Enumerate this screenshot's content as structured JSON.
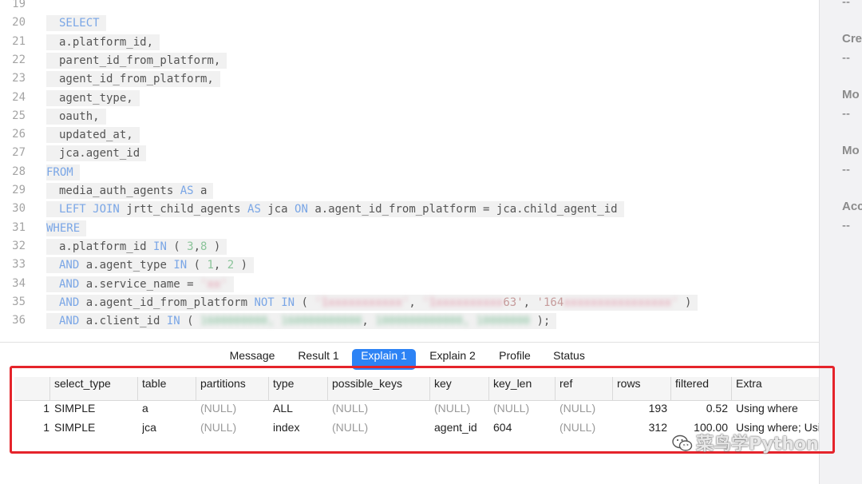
{
  "editor": {
    "lines": [
      {
        "n": "19",
        "text": ""
      },
      {
        "n": "20",
        "segs": [
          [
            "kw",
            "SELECT"
          ]
        ]
      },
      {
        "n": "21",
        "segs": [
          [
            "t",
            "a.platform_id,"
          ]
        ]
      },
      {
        "n": "22",
        "segs": [
          [
            "t",
            "parent_id_from_platform,"
          ]
        ]
      },
      {
        "n": "23",
        "segs": [
          [
            "t",
            "agent_id_from_platform,"
          ]
        ]
      },
      {
        "n": "24",
        "segs": [
          [
            "t",
            "agent_type,"
          ]
        ]
      },
      {
        "n": "25",
        "segs": [
          [
            "t",
            "oauth,"
          ]
        ]
      },
      {
        "n": "26",
        "segs": [
          [
            "t",
            "updated_at,"
          ]
        ]
      },
      {
        "n": "27",
        "segs": [
          [
            "t",
            "jca.agent_id"
          ]
        ]
      },
      {
        "n": "28",
        "segs": [
          [
            "kw",
            "FROM"
          ]
        ],
        "outdent": true
      },
      {
        "n": "29",
        "segs": [
          [
            "t",
            "media_auth_agents "
          ],
          [
            "kw",
            "AS"
          ],
          [
            "t",
            " a"
          ]
        ]
      },
      {
        "n": "30",
        "segs": [
          [
            "kw",
            "LEFT JOIN"
          ],
          [
            "t",
            " jrtt_child_agents "
          ],
          [
            "kw",
            "AS"
          ],
          [
            "t",
            " jca "
          ],
          [
            "kw",
            "ON"
          ],
          [
            "t",
            " a.agent_id_from_platform = jca.child_agent_id"
          ]
        ]
      },
      {
        "n": "31",
        "segs": [
          [
            "kw",
            "WHERE"
          ]
        ],
        "outdent": true
      },
      {
        "n": "32",
        "segs": [
          [
            "t",
            "a.platform_id "
          ],
          [
            "kw",
            "IN"
          ],
          [
            "t",
            " ( "
          ],
          [
            "num",
            "3"
          ],
          [
            "t",
            ","
          ],
          [
            "num",
            "8"
          ],
          [
            "t",
            " )"
          ]
        ]
      },
      {
        "n": "33",
        "segs": [
          [
            "kw",
            "AND"
          ],
          [
            "t",
            " a.agent_type "
          ],
          [
            "kw",
            "IN"
          ],
          [
            "t",
            " ( "
          ],
          [
            "num",
            "1"
          ],
          [
            "t",
            ", "
          ],
          [
            "num",
            "2"
          ],
          [
            "t",
            " )"
          ]
        ]
      },
      {
        "n": "34",
        "segs": [
          [
            "kw",
            "AND"
          ],
          [
            "t",
            " a.service_name = "
          ],
          [
            "blur-r",
            "'xx'"
          ]
        ]
      },
      {
        "n": "35",
        "segs": [
          [
            "kw",
            "AND"
          ],
          [
            "t",
            " a.agent_id_from_platform "
          ],
          [
            "kw",
            "NOT"
          ],
          [
            "t",
            " "
          ],
          [
            "kw",
            "IN"
          ],
          [
            "t",
            " ( "
          ],
          [
            "blur-r",
            "'1xxxxxxxxxxx'"
          ],
          [
            "t",
            ", "
          ],
          [
            "blur-r",
            "'1xxxxxxxxxx"
          ],
          [
            "str",
            "63'"
          ],
          [
            "t",
            ", "
          ],
          [
            "str",
            "'164"
          ],
          [
            "blur-r",
            "xxxxxxxxxxxxxxxx'"
          ],
          [
            "t",
            " )"
          ]
        ]
      },
      {
        "n": "36",
        "segs": [
          [
            "kw",
            "AND"
          ],
          [
            "t",
            " a.client_id "
          ],
          [
            "kw",
            "IN"
          ],
          [
            "t",
            " ( "
          ],
          [
            "blur-g",
            "1600000000, 160000000000"
          ],
          [
            "t",
            ", "
          ],
          [
            "blur-g",
            "1000000000000, 10000000"
          ],
          [
            "t",
            " );"
          ]
        ]
      }
    ]
  },
  "side": {
    "items": [
      {
        "label": "",
        "value": "--"
      },
      {
        "label": "Cre",
        "value": "--"
      },
      {
        "label": "Mo",
        "value": "--"
      },
      {
        "label": "Mo",
        "value": "--"
      },
      {
        "label": "Acc",
        "value": "--"
      }
    ]
  },
  "tabs": [
    {
      "label": "Message",
      "active": false
    },
    {
      "label": "Result 1",
      "active": false
    },
    {
      "label": "Explain 1",
      "active": true
    },
    {
      "label": "Explain 2",
      "active": false
    },
    {
      "label": "Profile",
      "active": false
    },
    {
      "label": "Status",
      "active": false
    }
  ],
  "grid": {
    "columns": [
      "select_type",
      "table",
      "partitions",
      "type",
      "possible_keys",
      "key",
      "key_len",
      "ref",
      "rows",
      "filtered",
      "Extra"
    ],
    "rows": [
      {
        "id": "1",
        "cells": [
          "SIMPLE",
          "a",
          "(NULL)",
          "ALL",
          "(NULL)",
          "(NULL)",
          "(NULL)",
          "(NULL)",
          "193",
          "0.52",
          "Using where"
        ]
      },
      {
        "id": "1",
        "cells": [
          "SIMPLE",
          "jca",
          "(NULL)",
          "index",
          "(NULL)",
          "agent_id",
          "604",
          "(NULL)",
          "312",
          "100.00",
          "Using where; Using index"
        ]
      }
    ]
  },
  "watermark": {
    "text": "菜鸟学Python"
  }
}
